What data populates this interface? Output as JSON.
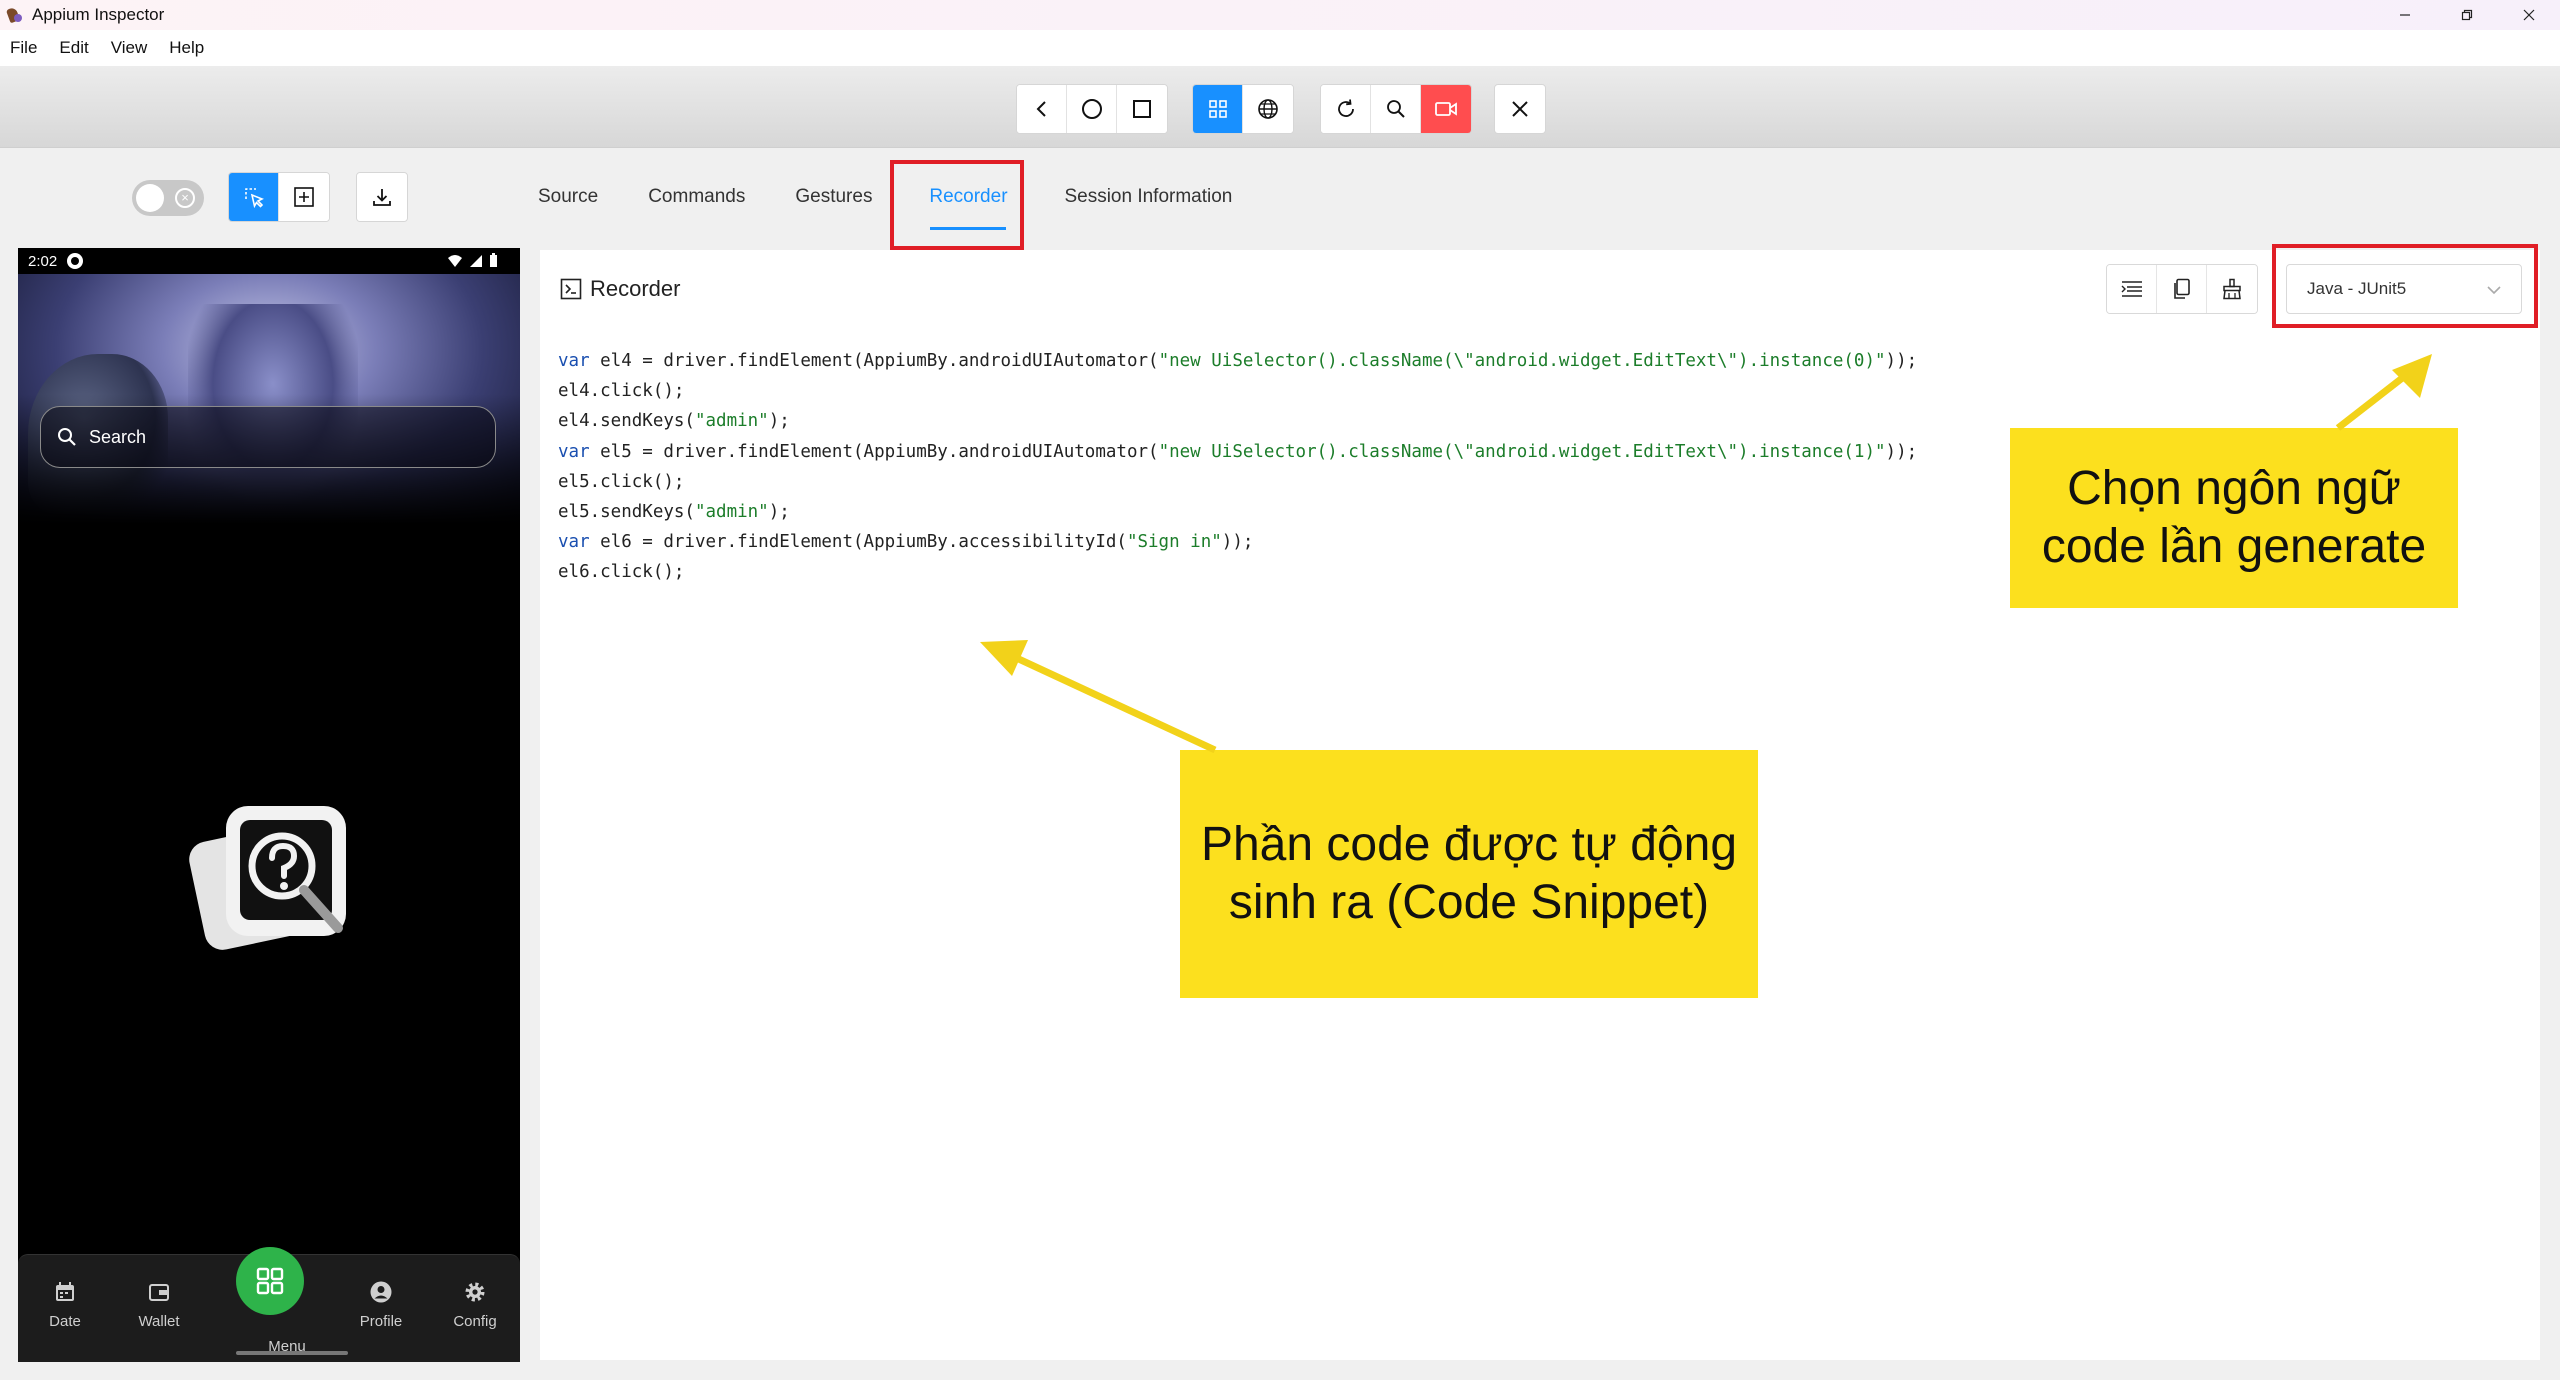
{
  "window": {
    "title": "Appium Inspector"
  },
  "menubar": {
    "items": [
      "File",
      "Edit",
      "View",
      "Help"
    ]
  },
  "tabs": [
    "Source",
    "Commands",
    "Gestures",
    "Recorder",
    "Session Information"
  ],
  "active_tab": "Recorder",
  "phone": {
    "time": "2:02",
    "search_placeholder": "Search",
    "nav": [
      "Date",
      "Wallet",
      "Menu",
      "Profile",
      "Config"
    ]
  },
  "recorder": {
    "title": "Recorder",
    "language": "Java - JUnit5",
    "code_lines": [
      [
        {
          "k": "kw",
          "t": "var"
        },
        {
          "t": " el4 = driver.findElement(AppiumBy.androidUIAutomator("
        },
        {
          "k": "str",
          "t": "\"new UiSelector().className(\\\"android.widget.EditText\\\").instance(0)\""
        },
        {
          "t": "));"
        }
      ],
      [
        {
          "t": "el4.click();"
        }
      ],
      [
        {
          "t": "el4.sendKeys("
        },
        {
          "k": "str",
          "t": "\"admin\""
        },
        {
          "t": ");"
        }
      ],
      [
        {
          "k": "kw",
          "t": "var"
        },
        {
          "t": " el5 = driver.findElement(AppiumBy.androidUIAutomator("
        },
        {
          "k": "str",
          "t": "\"new UiSelector().className(\\\"android.widget.EditText\\\").instance(1)\""
        },
        {
          "t": "));"
        }
      ],
      [
        {
          "t": "el5.click();"
        }
      ],
      [
        {
          "t": "el5.sendKeys("
        },
        {
          "k": "str",
          "t": "\"admin\""
        },
        {
          "t": ");"
        }
      ],
      [
        {
          "k": "kw",
          "t": "var"
        },
        {
          "t": " el6 = driver.findElement(AppiumBy.accessibilityId("
        },
        {
          "k": "str",
          "t": "\"Sign in\""
        },
        {
          "t": "));"
        }
      ],
      [
        {
          "t": "el6.click();"
        }
      ]
    ]
  },
  "annotations": {
    "code_callout": [
      "Phần code được tự động",
      "sinh ra (Code Snippet)"
    ],
    "lang_callout": [
      "Chọn ngôn ngữ",
      "code lần generate"
    ],
    "highlight_color": "#e01e26",
    "callout_color": "#fce01e"
  },
  "colors": {
    "accent": "#1890ff",
    "record": "#ff4d4f",
    "menu_fab": "#2eb34a"
  }
}
